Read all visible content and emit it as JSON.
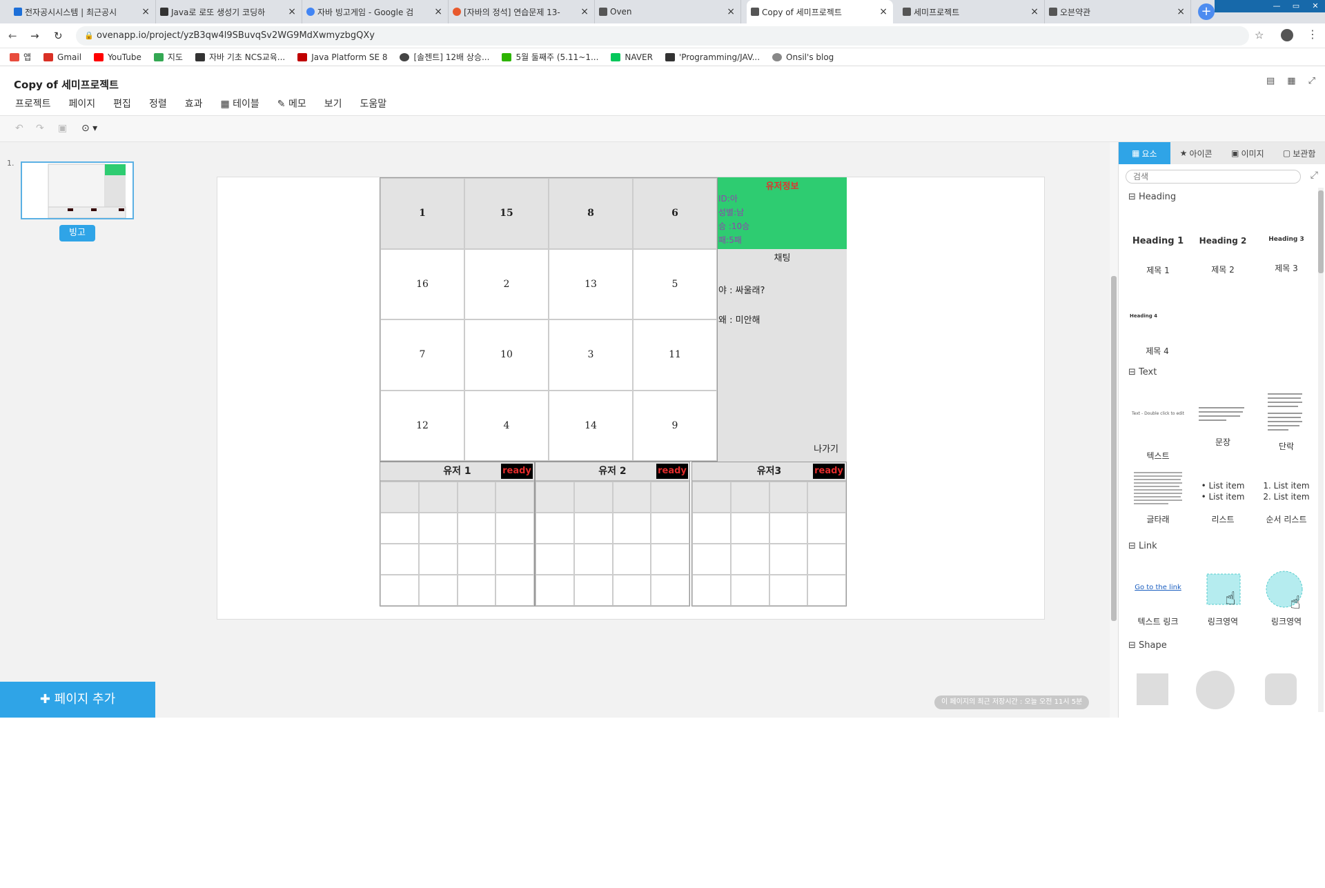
{
  "browser": {
    "tabs": [
      {
        "title": "전자공시시스템 | 최근공시",
        "color": "#1d6fd8"
      },
      {
        "title": "Java로 로또 생성기 코딩하",
        "color": "#333333"
      },
      {
        "title": "자바 빙고게임 - Google 검",
        "color": "#4285f4"
      },
      {
        "title": "[자바의 정석] 연습문제 13-",
        "color": "#e8592d"
      },
      {
        "title": "Oven",
        "color": "#555555"
      },
      {
        "title": "Copy of 세미프로젝트",
        "color": "#555555"
      },
      {
        "title": "세미프로젝트",
        "color": "#555555"
      },
      {
        "title": "오븐약관",
        "color": "#555555"
      }
    ],
    "url": "ovenapp.io/project/yzB3qw4l9SBuvqSv2WG9MdXwmyzbgQXy",
    "bookmarks": [
      {
        "label": "앱",
        "color": "#e84c3d"
      },
      {
        "label": "Gmail",
        "color": "#d93025"
      },
      {
        "label": "YouTube",
        "color": "#ff0000"
      },
      {
        "label": "지도",
        "color": "#34a853"
      },
      {
        "label": "자바 기초 NCS교육...",
        "color": "#333333"
      },
      {
        "label": "Java Platform SE 8",
        "color": "#c00000"
      },
      {
        "label": "[솔젠트] 12배 상승...",
        "color": "#444444"
      },
      {
        "label": "5월 둘째주 (5.11~1...",
        "color": "#2db400"
      },
      {
        "label": "NAVER",
        "color": "#03c75a"
      },
      {
        "label": "'Programming/JAV...",
        "color": "#333333"
      },
      {
        "label": "Onsil's blog",
        "color": "#888888"
      }
    ]
  },
  "app": {
    "project_title": "Copy of 세미프로젝트",
    "menu": [
      "프로젝트",
      "페이지",
      "편집",
      "정렬",
      "효과",
      "테이블",
      "메모",
      "보기",
      "도움말"
    ],
    "page_number": "1.",
    "page_label": "빙고",
    "add_page": "페이지 추가",
    "saved_status": "이 페이지의 최근 저장시간 : 오늘 오전 11시 5분"
  },
  "bingo": {
    "cells": [
      "1",
      "15",
      "8",
      "6",
      "16",
      "2",
      "13",
      "5",
      "7",
      "10",
      "3",
      "11",
      "12",
      "4",
      "14",
      "9"
    ],
    "userinfo_title": "유저정보",
    "userinfo_lines": [
      "ID:아",
      "성별:남",
      "승 :10승",
      "패:5패"
    ],
    "chat_title": "채팅",
    "chat_messages": [
      "야 : 싸울래?",
      "왜 : 미안해"
    ],
    "exit_label": "나가기",
    "users": [
      {
        "name": "유저 1",
        "status": "ready"
      },
      {
        "name": "유저 2",
        "status": "ready"
      },
      {
        "name": "유저3",
        "status": "ready"
      }
    ]
  },
  "panel": {
    "tabs": [
      "요소",
      "아이콘",
      "이미지",
      "보관함"
    ],
    "search_placeholder": "검색",
    "sections": {
      "heading": "Heading",
      "text": "Text",
      "link": "Link",
      "shape": "Shape"
    },
    "heading_samples": [
      "Heading 1",
      "Heading 2",
      "Heading 3",
      "Heading 4"
    ],
    "heading_labels": [
      "제목 1",
      "제목 2",
      "제목 3",
      "제목 4"
    ],
    "text_preview": "Text - Double click to edit",
    "text_labels": [
      "텍스트",
      "문장",
      "단락",
      "글타래",
      "리스트",
      "순서 리스트"
    ],
    "list_items": [
      "• List item",
      "• List item"
    ],
    "ordered_items": [
      "1. List item",
      "2. List item"
    ],
    "link_preview": "Go to the link",
    "link_labels": [
      "텍스트 링크",
      "링크영역",
      "링크영역"
    ]
  }
}
